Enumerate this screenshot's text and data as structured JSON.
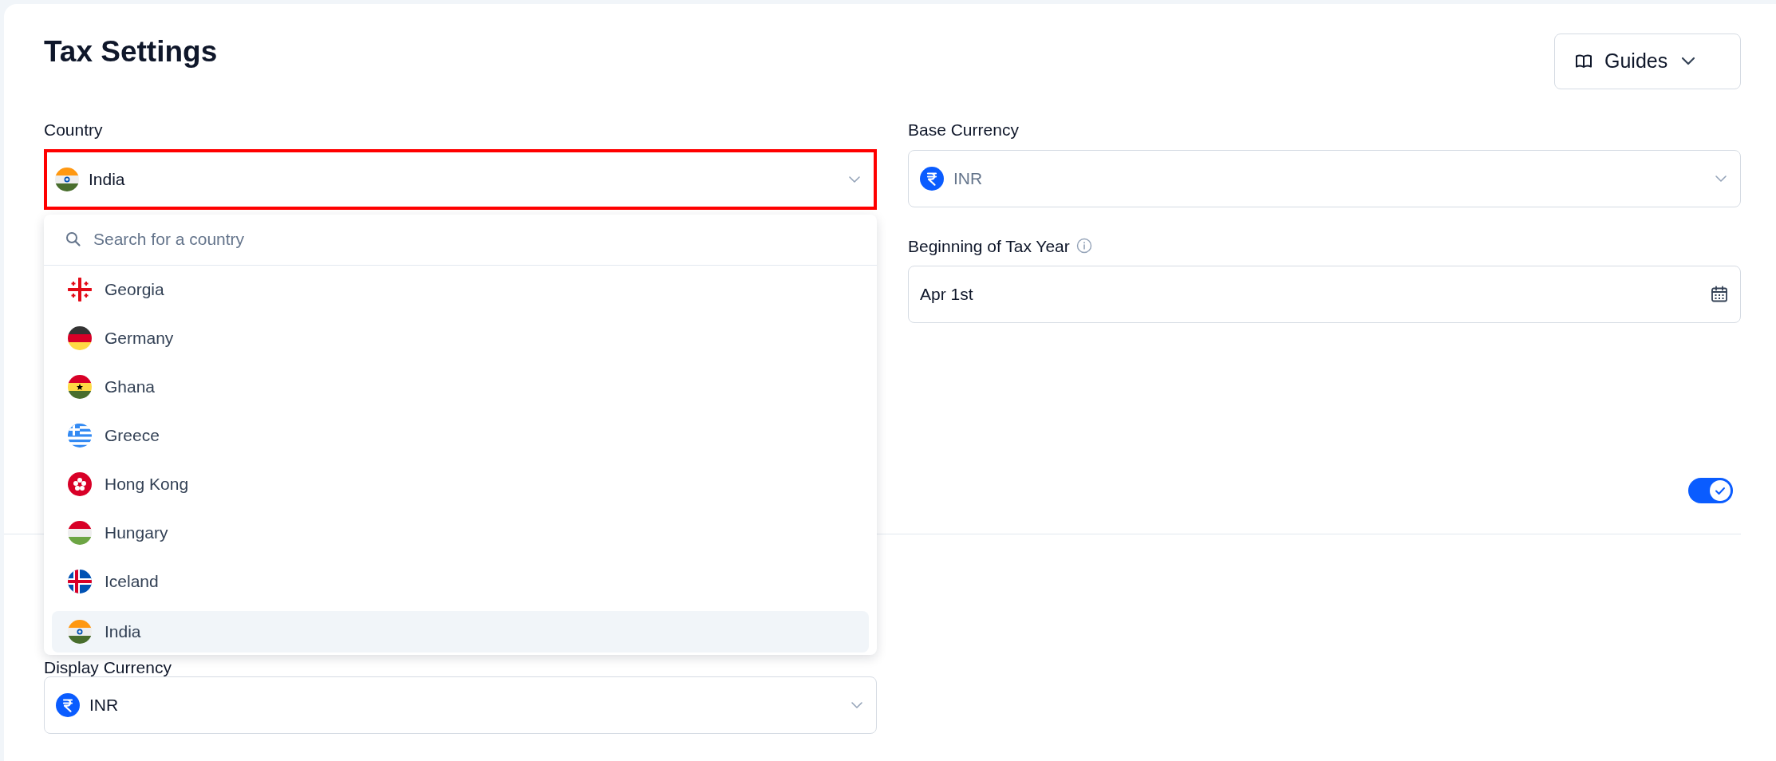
{
  "page": {
    "title": "Tax Settings"
  },
  "guides_button": {
    "label": "Guides"
  },
  "country": {
    "label": "Country",
    "value": "India",
    "expanded": true,
    "highlighted": true
  },
  "country_menu": {
    "search_placeholder": "Search for a country",
    "items": [
      {
        "label": "Georgia",
        "selected": false
      },
      {
        "label": "Germany",
        "selected": false
      },
      {
        "label": "Ghana",
        "selected": false
      },
      {
        "label": "Greece",
        "selected": false
      },
      {
        "label": "Hong Kong",
        "selected": false
      },
      {
        "label": "Hungary",
        "selected": false
      },
      {
        "label": "Iceland",
        "selected": false
      },
      {
        "label": "India",
        "selected": true
      }
    ]
  },
  "base_currency": {
    "label": "Base Currency",
    "value": "INR",
    "disabled": true
  },
  "tax_year": {
    "label": "Beginning of Tax Year",
    "value": "Apr 1st"
  },
  "toggle": {
    "on": true
  },
  "display_currency": {
    "label": "Display Currency",
    "value": "INR",
    "disabled": false
  }
}
